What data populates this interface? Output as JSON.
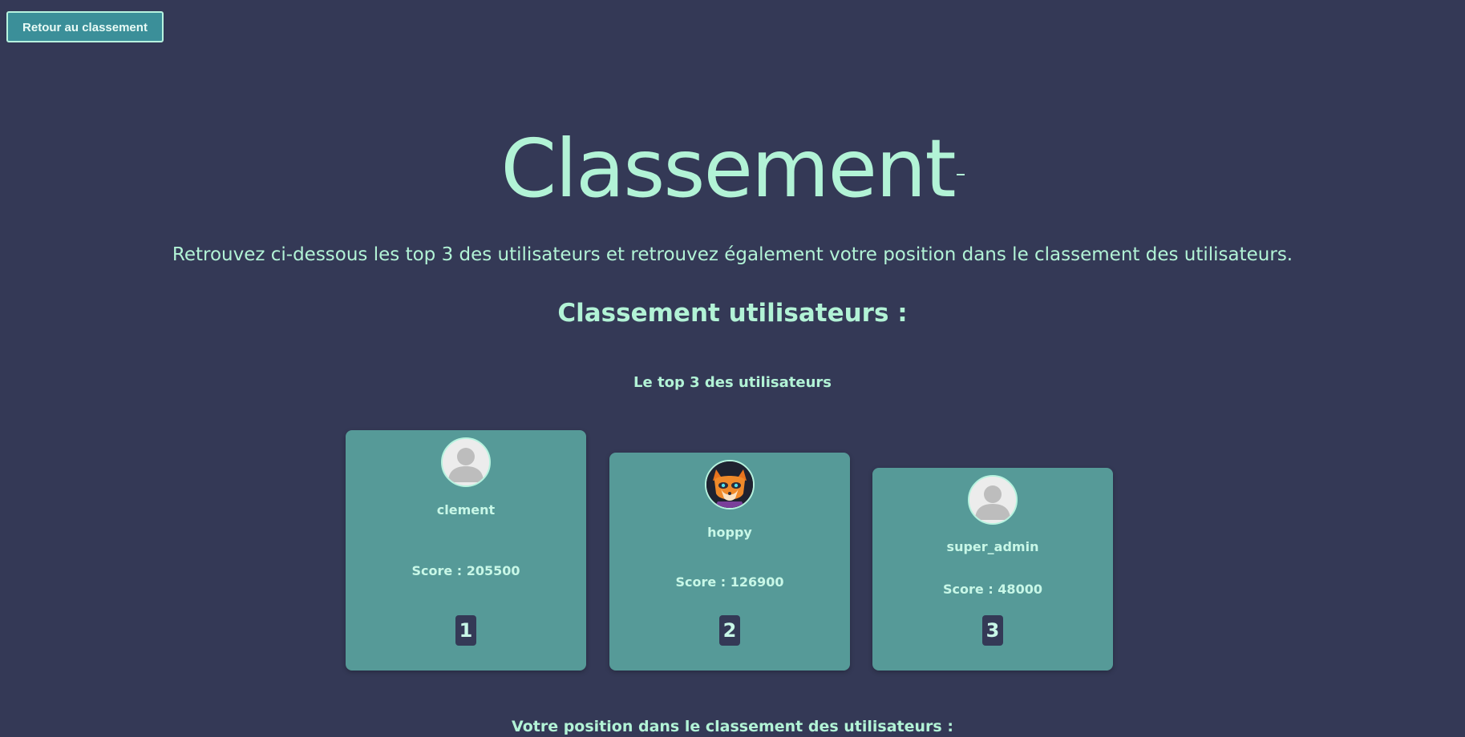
{
  "header": {
    "back_button_label": "Retour au classement"
  },
  "main": {
    "title": "Classement",
    "subtitle": "Retrouvez ci-dessous les top 3 des utilisateurs et retrouvez également votre position dans le classement des utilisateurs.",
    "section_title": "Classement utilisateurs :",
    "top3_title": "Le top 3 des utilisateurs",
    "position_title": "Votre position dans le classement des utilisateurs :"
  },
  "top3": [
    {
      "name": "clement",
      "score": "Score : 205500",
      "rank": "1",
      "avatar": "default-user-icon"
    },
    {
      "name": "hoppy",
      "score": "Score : 126900",
      "rank": "2",
      "avatar": "fox-avatar"
    },
    {
      "name": "super_admin",
      "score": "Score : 48000",
      "rank": "3",
      "avatar": "default-user-icon"
    }
  ],
  "colors": {
    "background": "#343956",
    "accent_text": "#b2f3d6",
    "card": "#569a98",
    "button": "#3b8f99"
  }
}
